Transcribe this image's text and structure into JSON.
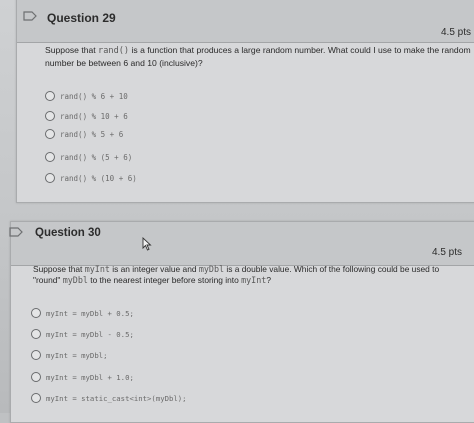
{
  "q29": {
    "title": "Question 29",
    "points": "4.5 pts",
    "text_1": "Suppose that ",
    "code_func": "rand()",
    "text_2": " is a function that produces a large random number. What could I use to make the random number be between 6 and 10 (inclusive)?",
    "options": [
      "rand() % 6 + 10",
      "rand() % 10 + 6",
      "rand() % 5 + 6",
      "rand() % (5 + 6)",
      "rand() % (10 + 6)"
    ]
  },
  "q30": {
    "title": "Question 30",
    "points": "4.5 pts",
    "text_1": "Suppose that ",
    "code_a": "myInt",
    "text_2": " is an integer value and ",
    "code_b": "myDbl",
    "text_3": " is a double value. Which of the following could be used to \"round\" ",
    "code_c": "myDbl",
    "text_4": " to the nearest integer before storing into ",
    "code_d": "myInt",
    "text_5": "?",
    "options": [
      "myInt = myDbl + 0.5;",
      "myInt = myDbl - 0.5;",
      "myInt = myDbl;",
      "myInt = myDbl + 1.0;",
      "myInt = static_cast<int>(myDbl);"
    ]
  }
}
